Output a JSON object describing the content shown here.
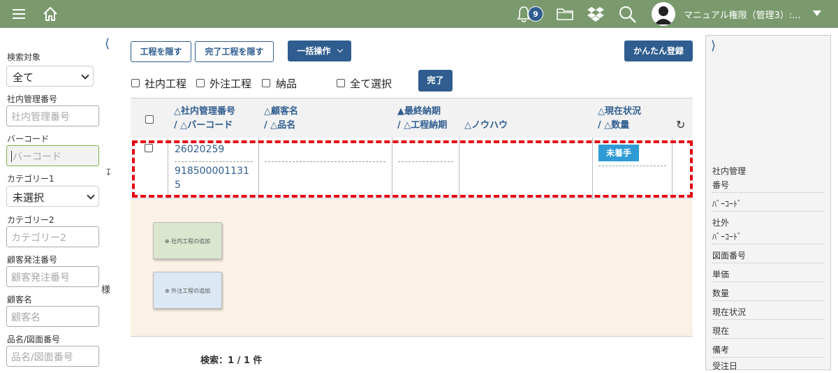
{
  "header": {
    "notification_count": "9",
    "user_name": "マニュアル権限（管理3）:..."
  },
  "sidebar": {
    "search_target_label": "検索対象",
    "search_target_value": "全て",
    "internal_no_label": "社内管理番号",
    "internal_no_placeholder": "社内管理番号",
    "barcode_label": "バーコード",
    "barcode_placeholder": "バーコード",
    "category1_label": "カテゴリー1",
    "category1_value": "未選択",
    "category2_label": "カテゴリー2",
    "category2_placeholder": "カテゴリー2",
    "customer_order_label": "顧客発注番号",
    "customer_order_placeholder": "顧客発注番号",
    "customer_label": "顧客名",
    "customer_placeholder": "顧客名",
    "customer_suffix": "様",
    "product_label": "品名/図面番号",
    "product_placeholder": "品名/図面番号"
  },
  "toolbar": {
    "hide_process": "工程を隠す",
    "hide_done_process": "完了工程を隠す",
    "bulk_action": "一括操作",
    "easy_register": "かんたん登録",
    "filter_internal": "社内工程",
    "filter_external": "外注工程",
    "filter_delivery": "納品",
    "select_all": "全て選択",
    "done": "完了"
  },
  "table": {
    "headers": {
      "col1_line1": "△社内管理番号",
      "col1_line2": "/ △バーコード",
      "col2_line1": "△顧客名",
      "col2_line2": "/ △品名",
      "col3_line1": "▲最終納期",
      "col3_line2": "/ △工程納期",
      "col4_line1": "△ノウハウ",
      "col5_line1": "△現在状況",
      "col5_line2": "/ △数量"
    },
    "row": {
      "internal_no": "26020259",
      "barcode_line1": "918500001131",
      "barcode_line2": "5",
      "status": "未着手"
    }
  },
  "dropzone": {
    "add_internal": "社内工程の追加",
    "add_external": "外注工程の追加"
  },
  "result_count": "検索：1 / 1 件",
  "detail_panel": {
    "items": [
      "社内管理",
      "番号",
      "ﾊﾞｰｺｰﾄﾞ",
      "社外",
      "ﾊﾞｰｺｰﾄﾞ",
      "図面番号",
      "単価",
      "数量",
      "現在状況",
      "現在",
      "備考",
      "受注日"
    ]
  }
}
